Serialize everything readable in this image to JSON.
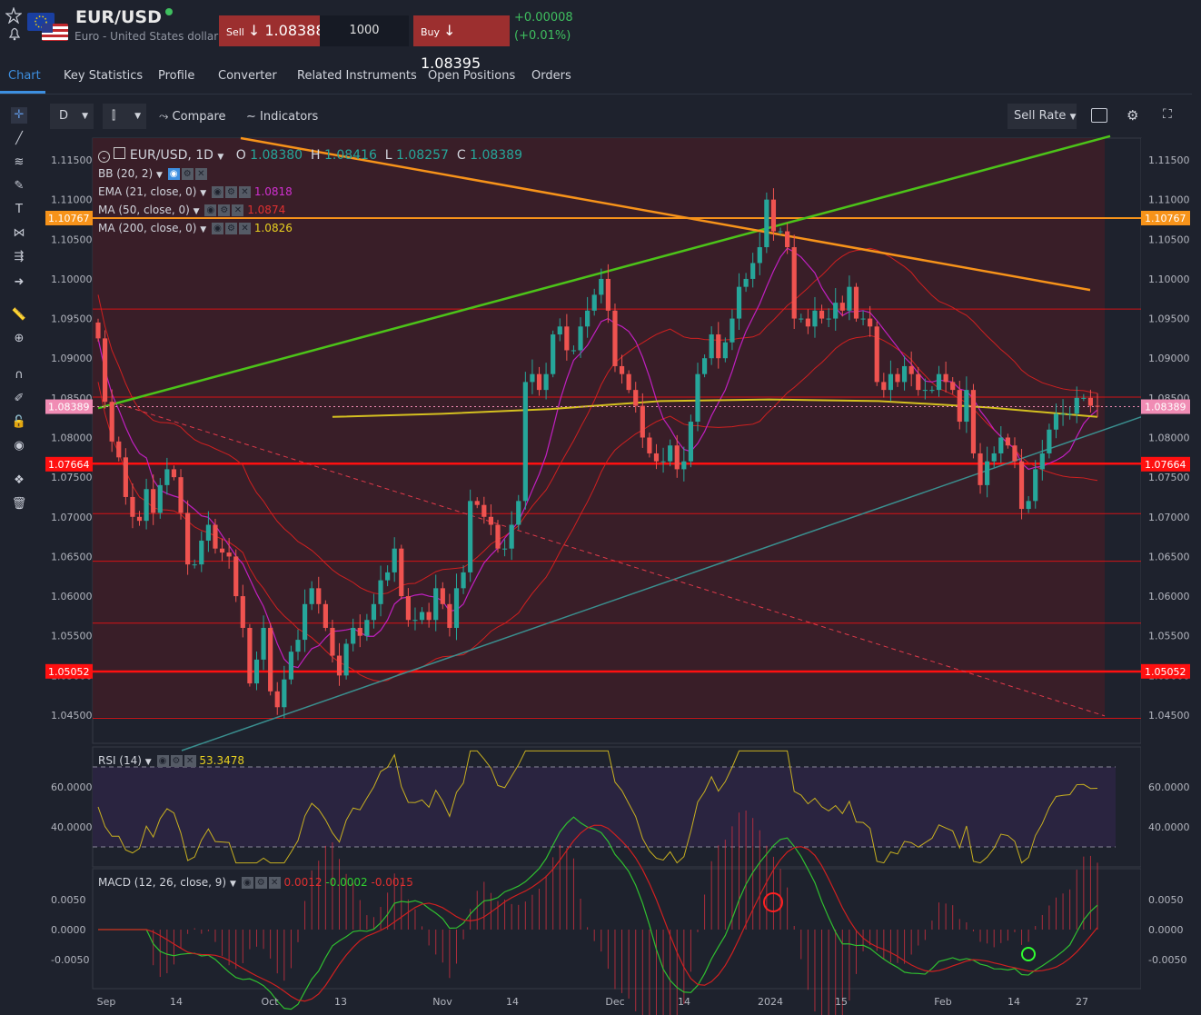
{
  "header": {
    "symbol": "EUR/USD",
    "description": "Euro - United States dollar",
    "sell_label": "Sell",
    "sell_price": "1.08388",
    "quantity": "1000",
    "buy_label": "Buy",
    "buy_price": "1.08395",
    "change_abs": "+0.00008",
    "change_pct": "(+0.01%)"
  },
  "tabs": [
    "Chart",
    "Key Statistics",
    "Profile",
    "Converter",
    "Related Instruments",
    "Open Positions",
    "Orders"
  ],
  "toolbar": {
    "interval": "D",
    "compare_label": "Compare",
    "indicators_label": "Indicators",
    "sell_rate_label": "Sell Rate"
  },
  "left_tools": [
    "crosshair-icon",
    "trendline-icon",
    "fib-icon",
    "brush-icon",
    "text-icon",
    "pattern-icon",
    "forecast-icon",
    "arrow-icon",
    "ruler-icon",
    "zoom-icon",
    "magnet-icon",
    "lock-drawing-icon",
    "lock-icon",
    "eye-icon",
    "layers-icon",
    "trash-icon"
  ],
  "legend": {
    "title": "EUR/USD, 1D",
    "o_label": "O",
    "o": "1.08380",
    "h_label": "H",
    "h": "1.08416",
    "l_label": "L",
    "l": "1.08257",
    "c_label": "C",
    "c": "1.08389",
    "bb": "BB (20, 2)",
    "ema": "EMA (21, close, 0)",
    "ema_value": "1.0818",
    "ma50": "MA (50, close, 0)",
    "ma50_value": "1.0874",
    "ma200": "MA (200, close, 0)",
    "ma200_value": "1.0826",
    "rsi": "RSI (14)",
    "rsi_value": "53.3478",
    "macd": "MACD (12, 26, close, 9)",
    "macd_v1": "0.0012",
    "macd_v2": "-0.0002",
    "macd_v3": "-0.0015"
  },
  "colors": {
    "up": "#26a69a",
    "down": "#ef5350",
    "ema": "#c020c0",
    "ma50": "#d02020",
    "ma200": "#d4c020",
    "green_line": "#4cc319",
    "orange_line": "#f7931a",
    "channel": "#3a8f8f",
    "hline": "#ff1010"
  },
  "chart_data": {
    "type": "candlestick",
    "x_tick_labels": [
      "Sep",
      "14",
      "Oct",
      "13",
      "Nov",
      "14",
      "Dec",
      "14",
      "2024",
      "15",
      "Feb",
      "14",
      "27"
    ],
    "y_tick_labels": [
      "1.11500",
      "1.11000",
      "1.10500",
      "1.10000",
      "1.09500",
      "1.09000",
      "1.08500",
      "1.08000",
      "1.07500",
      "1.07000",
      "1.06500",
      "1.06000",
      "1.05500",
      "1.05000",
      "1.04500"
    ],
    "price_tags": [
      {
        "value": "1.10767",
        "color": "#f7931a"
      },
      {
        "value": "1.08389",
        "color": "#f08cb4"
      },
      {
        "value": "1.07664",
        "color": "#ff1010"
      },
      {
        "value": "1.05052",
        "color": "#ff1010"
      }
    ],
    "horizontal_levels": [
      1.0962,
      1.0851,
      1.0767,
      1.0704,
      1.0644,
      1.0566,
      1.0505,
      1.0446
    ],
    "closes": [
      1.0925,
      1.0845,
      1.0795,
      1.0775,
      1.0725,
      1.07,
      1.0695,
      1.0735,
      1.0705,
      1.074,
      1.076,
      1.075,
      1.0705,
      1.064,
      1.064,
      1.067,
      1.069,
      1.066,
      1.0655,
      1.065,
      1.06,
      1.056,
      1.049,
      1.052,
      1.056,
      1.048,
      1.046,
      1.0495,
      1.053,
      1.0545,
      1.059,
      1.061,
      1.059,
      1.056,
      1.0525,
      1.05,
      1.054,
      1.056,
      1.055,
      1.057,
      1.059,
      1.062,
      1.063,
      1.066,
      1.06,
      1.057,
      1.057,
      1.058,
      1.057,
      1.061,
      1.059,
      1.056,
      1.061,
      1.063,
      1.072,
      1.0715,
      1.07,
      1.069,
      1.066,
      1.066,
      1.069,
      1.072,
      1.087,
      1.088,
      1.086,
      1.088,
      1.093,
      1.094,
      1.091,
      1.091,
      1.094,
      1.096,
      1.098,
      1.1,
      1.096,
      1.089,
      1.088,
      1.086,
      1.084,
      1.08,
      1.078,
      1.077,
      1.077,
      1.079,
      1.076,
      1.077,
      1.082,
      1.088,
      1.09,
      1.093,
      1.09,
      1.092,
      1.095,
      1.099,
      1.1,
      1.102,
      1.104,
      1.11,
      1.106,
      1.106,
      1.104,
      1.095,
      1.095,
      1.094,
      1.096,
      1.095,
      1.095,
      1.097,
      1.096,
      1.099,
      1.095,
      1.095,
      1.094,
      1.087,
      1.086,
      1.088,
      1.087,
      1.089,
      1.088,
      1.086,
      1.086,
      1.086,
      1.088,
      1.087,
      1.086,
      1.082,
      1.086,
      1.078,
      1.074,
      1.077,
      1.078,
      1.08,
      1.079,
      1.077,
      1.071,
      1.072,
      1.076,
      1.078,
      1.081,
      1.083,
      1.083,
      1.083,
      1.085,
      1.085,
      1.084,
      1.0839
    ],
    "ma200_values": [
      1.0826,
      1.083,
      1.0836,
      1.0846,
      1.0848,
      1.0846,
      1.0838,
      1.0826
    ],
    "rsi_range": [
      20,
      80
    ],
    "rsi_guides": [
      70,
      30
    ],
    "rsi_y_ticks": [
      "60.0000",
      "40.0000"
    ],
    "macd_y_ticks": [
      "0.0050",
      "0.0000",
      "-0.0050"
    ]
  }
}
